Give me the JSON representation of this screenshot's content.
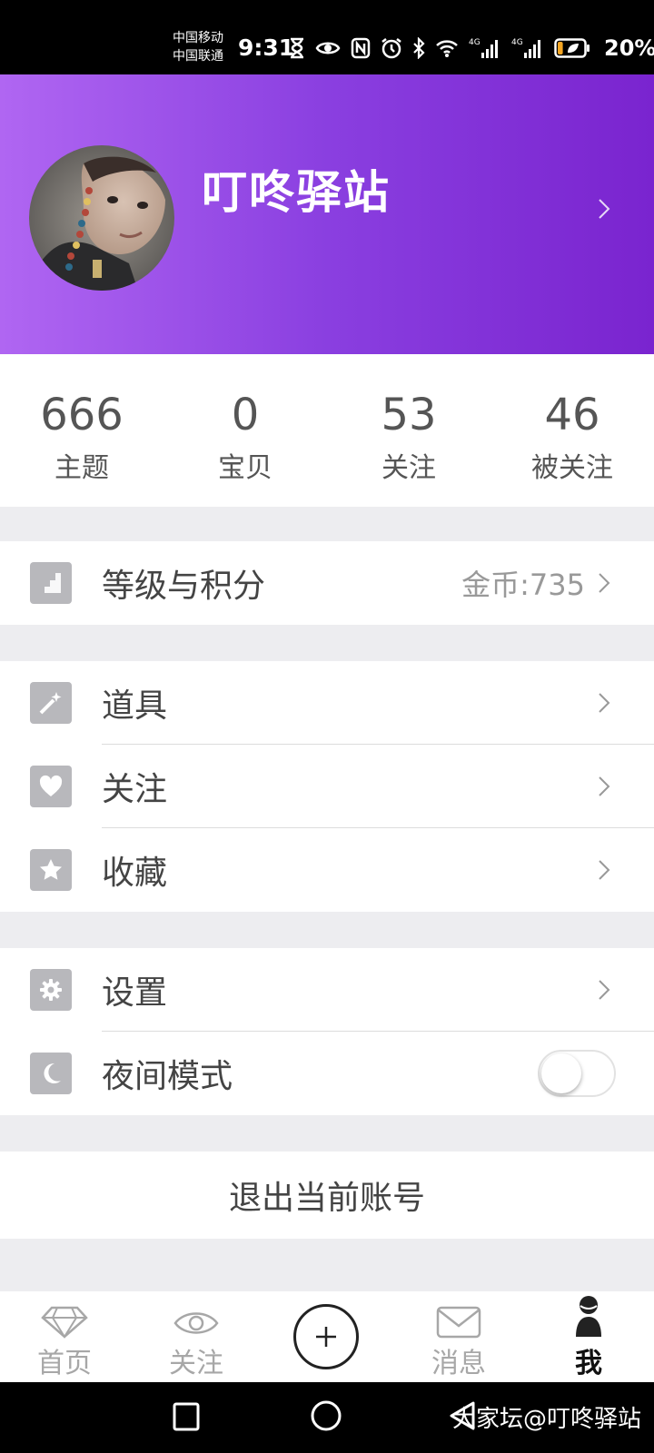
{
  "status_bar": {
    "carrier1": "中国移动",
    "carrier2": "中国联通",
    "time": "9:31",
    "network1": "4G",
    "network2": "4G",
    "battery": "20%",
    "battery_level": 0.2
  },
  "profile": {
    "username": "叮咚驿站"
  },
  "stats": [
    {
      "value": "666",
      "label": "主题"
    },
    {
      "value": "0",
      "label": "宝贝"
    },
    {
      "value": "53",
      "label": "关注"
    },
    {
      "value": "46",
      "label": "被关注"
    }
  ],
  "menu": {
    "level": {
      "label": "等级与积分",
      "value": "金币:735",
      "icon": "level-icon"
    },
    "props": {
      "label": "道具",
      "icon": "magic-wand-icon"
    },
    "follow": {
      "label": "关注",
      "icon": "heart-icon"
    },
    "favorites": {
      "label": "收藏",
      "icon": "star-icon"
    },
    "settings": {
      "label": "设置",
      "icon": "gear-icon"
    },
    "night_mode": {
      "label": "夜间模式",
      "icon": "moon-icon",
      "enabled": false
    }
  },
  "logout_label": "退出当前账号",
  "tabs": [
    {
      "label": "首页",
      "icon": "diamond-icon",
      "active": false
    },
    {
      "label": "关注",
      "icon": "eye-icon",
      "active": false
    },
    {
      "label": "",
      "icon": "plus-icon",
      "active": false
    },
    {
      "label": "消息",
      "icon": "mail-icon",
      "active": false
    },
    {
      "label": "我",
      "icon": "person-icon",
      "active": true
    }
  ],
  "watermark": "大家坛@叮咚驿站",
  "colors": {
    "header_start": "#b066f2",
    "header_end": "#7a24cf"
  }
}
